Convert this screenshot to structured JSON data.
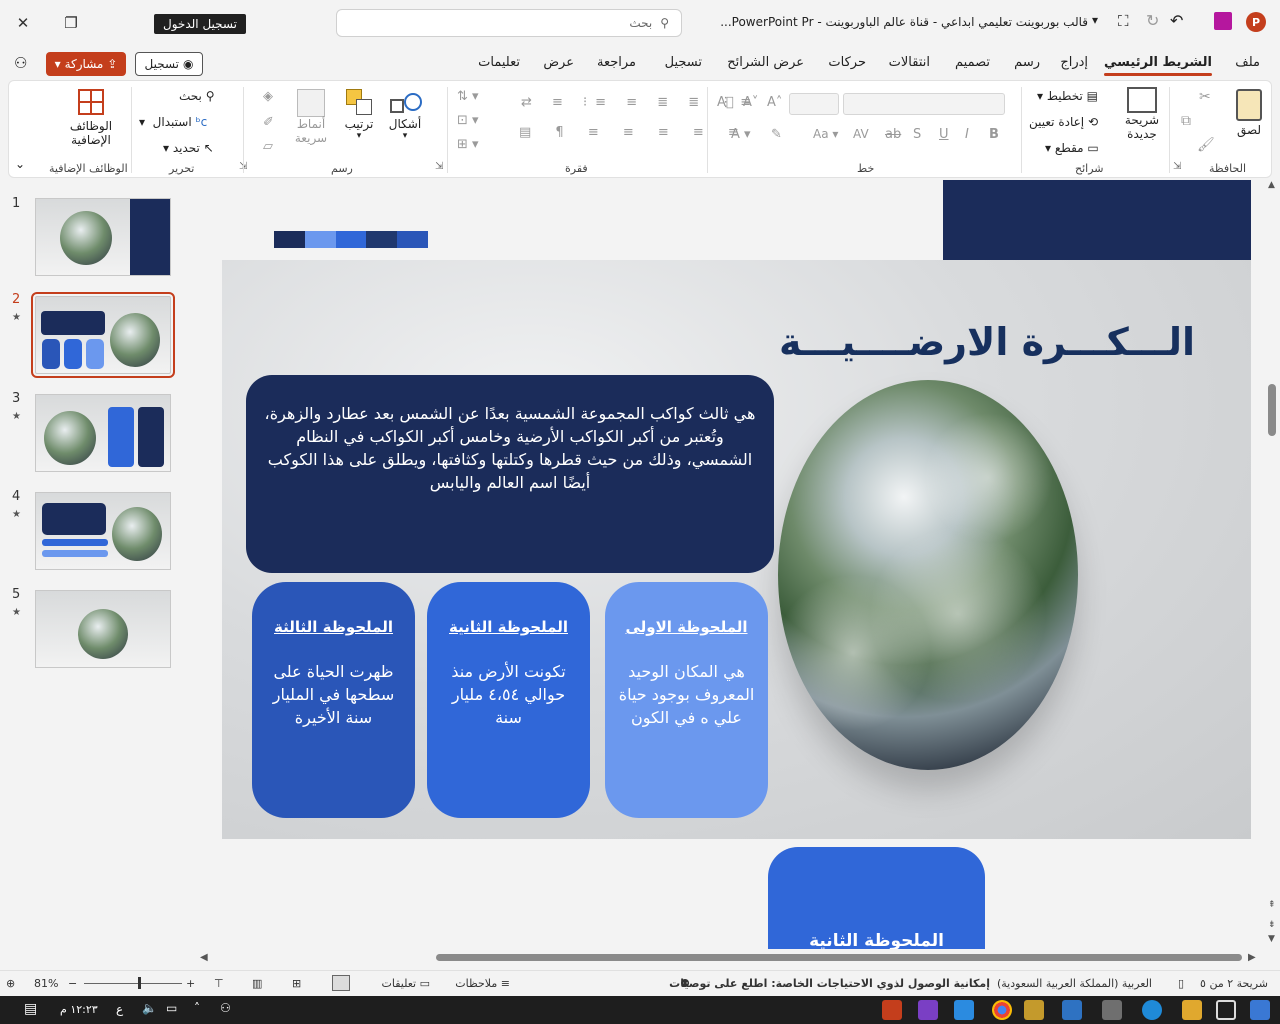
{
  "window": {
    "title": "قالب بوربوينت تعليمي ابداعي - قناة عالم الباوربوينت  -  PowerPoint Pr...",
    "signin_label": "تسجيل الدخول",
    "search_placeholder": "بحث"
  },
  "tabs": [
    "ملف",
    "الشريط الرئيسي",
    "إدراج",
    "رسم",
    "تصميم",
    "انتقالات",
    "حركات",
    "عرض الشرائح",
    "تسجيل",
    "مراجعة",
    "عرض",
    "تعليمات"
  ],
  "share_label": "مشاركة",
  "record_label": "تسجيل",
  "ribbon": {
    "clipboard": {
      "label": "الحافظة",
      "paste": "لصق"
    },
    "slides": {
      "label": "شرائح",
      "new_slide": "شريحة جديدة",
      "layout": "تخطيط",
      "reset": "إعادة تعيين",
      "section": "مقطع"
    },
    "font": {
      "label": "خط"
    },
    "paragraph": {
      "label": "فقرة"
    },
    "drawing": {
      "label": "رسم",
      "shapes": "أشكال",
      "arrange": "ترتيب",
      "quick_styles": "أنماط سريعة"
    },
    "editing": {
      "label": "تحرير",
      "find": "بحث",
      "replace": "استبدال",
      "select": "تحديد"
    },
    "addins": {
      "label": "الوظائف الإضافية",
      "button": "الوظائف الإضافية"
    }
  },
  "thumbnails": [
    "1",
    "2",
    "3",
    "4",
    "5"
  ],
  "slide": {
    "title": "الـــكـــرة الارضــــيـــة",
    "main_text": "هي ثالث كواكب المجموعة الشمسية بعدًا عن الشمس بعد عطارد والزهرة، وتُعتبر من أكبر الكواكب الأرضية وخامس أكبر الكواكب في النظام الشمسي، وذلك من حيث قطرها وكتلتها وكثافتها، ويطلق على هذا الكوكب أيضًا اسم العالم واليابس",
    "notes": [
      {
        "title": "الملحوظة الاولى",
        "text": "هي المكان الوحيد المعروف بوجود حياة علي ه في الكون",
        "color": "#6b98ee"
      },
      {
        "title": "الملحوظة الثانية",
        "text": "تكونت الأرض منذ حوالي ٤،٥٤ مليار سنة",
        "color": "#3067d8"
      },
      {
        "title": "الملحوظة الثالثة",
        "text": "ظهرت الحياة على سطحها في المليار سنة الأخيرة",
        "color": "#2a56b8"
      }
    ],
    "next_note_title": "الملحوظة الثانية"
  },
  "status": {
    "slide_count": "شريحة ٢ من ٥",
    "language": "العربية (المملكة العربية السعودية)",
    "accessibility": "إمكانية الوصول لذوي الاحتياجات الخاصة: اطلع على توصيات",
    "notes_label": "ملاحظات",
    "comments_label": "تعليقات",
    "zoom": "81%"
  },
  "taskbar": {
    "time": "١٢:٢٣ م",
    "lang": "ع"
  },
  "colors": {
    "accent": "#c43e1c",
    "navy": "#1b2c5a",
    "title": "#17305e"
  }
}
